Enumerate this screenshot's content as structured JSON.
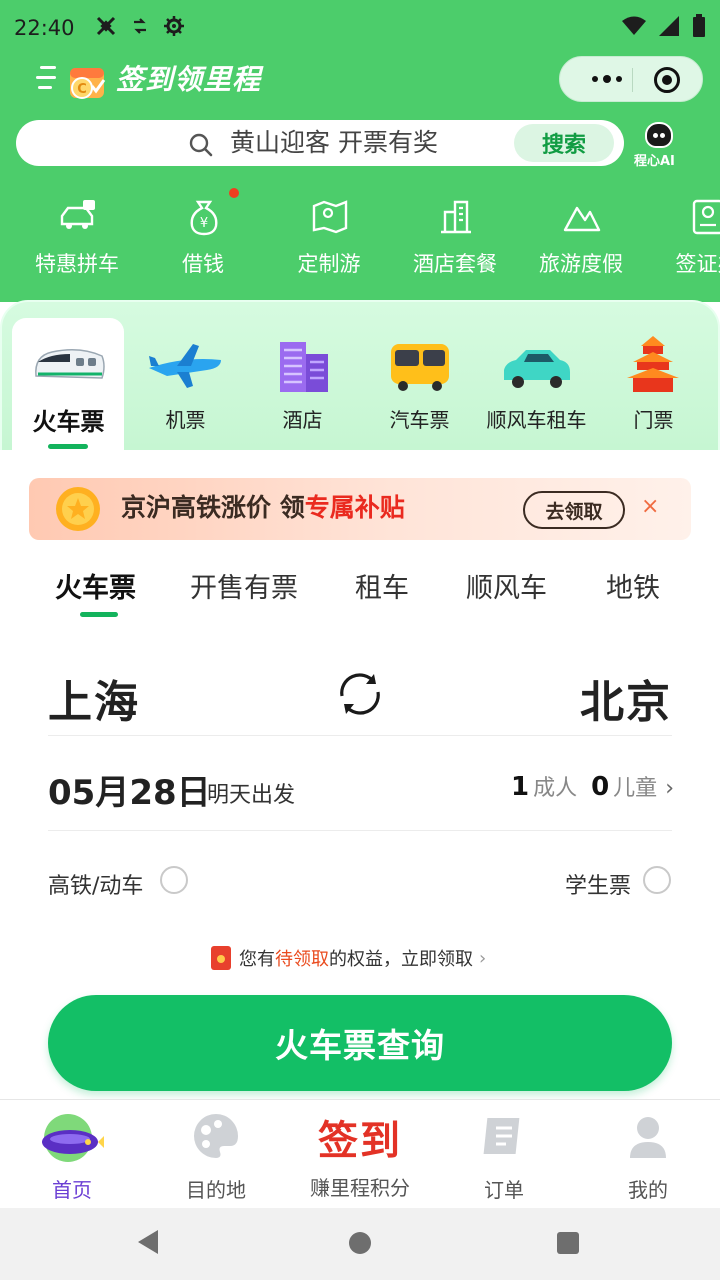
{
  "status_bar": {
    "time": "22:40",
    "icons": [
      "crossed-tools-icon",
      "data-icon",
      "gear-icon",
      "wifi-icon",
      "signal-icon",
      "battery-icon"
    ]
  },
  "header": {
    "title": "签到领里程",
    "capsule": {
      "more": "more-icon",
      "close": "close-icon"
    }
  },
  "search": {
    "placeholder": "黄山迎客 开票有奖",
    "button": "搜索",
    "ai_label": "程心AI"
  },
  "quick_services": [
    {
      "label": "特惠拼车",
      "icon": "carpool-icon"
    },
    {
      "label": "借钱",
      "icon": "money-bag-icon",
      "badge": true
    },
    {
      "label": "定制游",
      "icon": "custom-tour-icon"
    },
    {
      "label": "酒店套餐",
      "icon": "hotel-package-icon"
    },
    {
      "label": "旅游度假",
      "icon": "mountain-icon"
    },
    {
      "label": "签证办",
      "icon": "visa-icon"
    }
  ],
  "categories": [
    {
      "label": "火车票",
      "icon": "train-icon",
      "active": true
    },
    {
      "label": "机票",
      "icon": "airplane-icon"
    },
    {
      "label": "酒店",
      "icon": "hotel-icon"
    },
    {
      "label": "汽车票",
      "icon": "bus-icon"
    },
    {
      "label": "顺风车租车",
      "icon": "car-icon"
    },
    {
      "label": "门票",
      "icon": "temple-icon"
    }
  ],
  "promo": {
    "text_main": "京沪高铁涨价 领",
    "text_highlight": "专属补贴",
    "button": "去领取",
    "close": "×"
  },
  "tabs": [
    {
      "label": "火车票",
      "active": true
    },
    {
      "label": "开售有票"
    },
    {
      "label": "租车"
    },
    {
      "label": "顺风车"
    },
    {
      "label": "地铁"
    }
  ],
  "route": {
    "from": "上海",
    "to": "北京"
  },
  "trip": {
    "date": "05月28日",
    "date_sub": "明天出发",
    "adults": "1",
    "adults_label": "成人",
    "children": "0",
    "children_label": "儿童",
    "chevron": "›"
  },
  "options": {
    "high_speed": "高铁/动车",
    "student": "学生票"
  },
  "benefit": {
    "prefix": "您有",
    "highlight": "待领取",
    "suffix": "的权益，立即领取",
    "chevron": "›"
  },
  "query_button": "火车票查询",
  "bottom_nav": [
    {
      "label": "首页",
      "icon": "home-blimp-icon",
      "active": true
    },
    {
      "label": "目的地",
      "icon": "palette-icon"
    },
    {
      "label": "赚里程积分",
      "icon_text": "签到"
    },
    {
      "label": "订单",
      "icon": "order-icon"
    },
    {
      "label": "我的",
      "icon": "profile-icon"
    }
  ],
  "colors": {
    "brand_green": "#4ccd6b",
    "button_green": "#13bf66",
    "accent_red": "#ea2a1f",
    "active_nav": "#6b3fd4"
  }
}
